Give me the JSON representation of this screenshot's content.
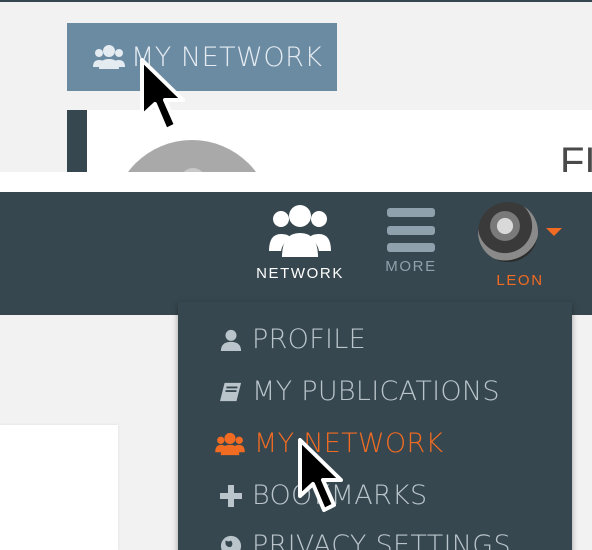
{
  "zoom_panel": {
    "button_label": "MY NETWORK",
    "button_icon": "users-icon",
    "edge_letter": "FI"
  },
  "navbar": {
    "items": [
      {
        "label": "NETWORK",
        "icon": "users-icon"
      },
      {
        "label": "MORE",
        "icon": "bars-icon"
      },
      {
        "label": "LEON",
        "icon": "avatar"
      }
    ],
    "colors": {
      "bar": "#37474f",
      "active": "#ffffff",
      "inactive": "#8ea1ad",
      "accent": "#f26b22"
    }
  },
  "dropdown": {
    "items": [
      {
        "label": "PROFILE",
        "icon": "user-icon"
      },
      {
        "label": "MY PUBLICATIONS",
        "icon": "book-icon"
      },
      {
        "label": "MY NETWORK",
        "icon": "users-icon",
        "active": true
      },
      {
        "label": "BOOKMARKS",
        "icon": "plus-icon"
      },
      {
        "label": "PRIVACY SETTINGS",
        "icon": "globe-icon"
      }
    ]
  }
}
